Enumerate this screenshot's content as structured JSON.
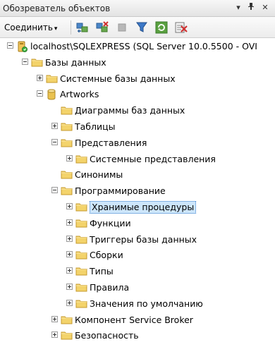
{
  "window": {
    "title": "Обозреватель объектов",
    "pin_glyph": "▾",
    "autohide_glyph": "ᛘ",
    "close_glyph": "✕"
  },
  "toolbar": {
    "connect_label": "Соединить",
    "connect_dropdown_glyph": "▾"
  },
  "tree": [
    {
      "label": "localhost\\SQLEXPRESS (SQL Server 10.0.5500 - OVI",
      "icon": "server-icon",
      "expander": "minus"
    },
    {
      "label": "Базы данных",
      "icon": "folder-icon",
      "expander": "minus"
    },
    {
      "label": "Системные базы данных",
      "icon": "folder-icon",
      "expander": "plus"
    },
    {
      "label": "Artworks",
      "icon": "database-icon",
      "expander": "minus"
    },
    {
      "label": "Диаграммы баз данных",
      "icon": "folder-icon",
      "expander": "none"
    },
    {
      "label": "Таблицы",
      "icon": "folder-icon",
      "expander": "plus"
    },
    {
      "label": "Представления",
      "icon": "folder-icon",
      "expander": "minus"
    },
    {
      "label": "Системные представления",
      "icon": "folder-icon",
      "expander": "plus"
    },
    {
      "label": "Синонимы",
      "icon": "folder-icon",
      "expander": "none"
    },
    {
      "label": "Программирование",
      "icon": "folder-icon",
      "expander": "minus"
    },
    {
      "label": "Хранимые процедуры",
      "icon": "folder-icon",
      "expander": "plus",
      "selected": true
    },
    {
      "label": "Функции",
      "icon": "folder-icon",
      "expander": "plus"
    },
    {
      "label": "Триггеры базы данных",
      "icon": "folder-icon",
      "expander": "plus"
    },
    {
      "label": "Сборки",
      "icon": "folder-icon",
      "expander": "plus"
    },
    {
      "label": "Типы",
      "icon": "folder-icon",
      "expander": "plus"
    },
    {
      "label": "Правила",
      "icon": "folder-icon",
      "expander": "plus"
    },
    {
      "label": "Значения по умолчанию",
      "icon": "folder-icon",
      "expander": "plus"
    },
    {
      "label": "Компонент Service Broker",
      "icon": "folder-icon",
      "expander": "plus"
    },
    {
      "label": "Безопасность",
      "icon": "folder-icon",
      "expander": "plus"
    }
  ],
  "colors": {
    "selection_bg": "#cde6fb",
    "folder_fill": "#f3d36b",
    "folder_stroke": "#c49a2c"
  }
}
